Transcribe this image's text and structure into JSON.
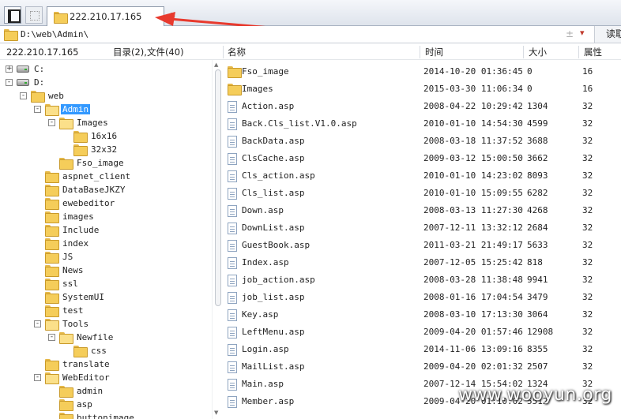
{
  "tab": {
    "label": "222.210.17.165",
    "add_label": "+"
  },
  "path_bar": {
    "value": "D:\\web\\Admin\\",
    "go_label": "读取",
    "pm": "±"
  },
  "tree_header": {
    "host": "222.210.17.165",
    "summary": "目录(2),文件(40)"
  },
  "columns": {
    "name": "名称",
    "time": "时间",
    "size": "大小",
    "attr": "属性"
  },
  "tree": [
    {
      "label": "C:",
      "level": 0,
      "type": "drive",
      "expander": "+"
    },
    {
      "label": "D:",
      "level": 0,
      "type": "drive",
      "expander": "-"
    },
    {
      "label": "web",
      "level": 1,
      "type": "folder",
      "expander": "-"
    },
    {
      "label": "Admin",
      "level": 2,
      "type": "folder-open",
      "expander": "-",
      "selected": true
    },
    {
      "label": "Images",
      "level": 3,
      "type": "folder-open",
      "expander": "-"
    },
    {
      "label": "16x16",
      "level": 4,
      "type": "folder",
      "expander": ""
    },
    {
      "label": "32x32",
      "level": 4,
      "type": "folder",
      "expander": ""
    },
    {
      "label": "Fso_image",
      "level": 3,
      "type": "folder",
      "expander": ""
    },
    {
      "label": "aspnet_client",
      "level": 2,
      "type": "folder",
      "expander": ""
    },
    {
      "label": "DataBaseJKZY",
      "level": 2,
      "type": "folder",
      "expander": ""
    },
    {
      "label": "ewebeditor",
      "level": 2,
      "type": "folder",
      "expander": ""
    },
    {
      "label": "images",
      "level": 2,
      "type": "folder",
      "expander": ""
    },
    {
      "label": "Include",
      "level": 2,
      "type": "folder",
      "expander": ""
    },
    {
      "label": "index",
      "level": 2,
      "type": "folder",
      "expander": ""
    },
    {
      "label": "JS",
      "level": 2,
      "type": "folder",
      "expander": ""
    },
    {
      "label": "News",
      "level": 2,
      "type": "folder",
      "expander": ""
    },
    {
      "label": "ssl",
      "level": 2,
      "type": "folder",
      "expander": ""
    },
    {
      "label": "SystemUI",
      "level": 2,
      "type": "folder",
      "expander": ""
    },
    {
      "label": "test",
      "level": 2,
      "type": "folder",
      "expander": ""
    },
    {
      "label": "Tools",
      "level": 2,
      "type": "folder-open",
      "expander": "-"
    },
    {
      "label": "Newfile",
      "level": 3,
      "type": "folder-open",
      "expander": "-"
    },
    {
      "label": "css",
      "level": 4,
      "type": "folder",
      "expander": ""
    },
    {
      "label": "translate",
      "level": 2,
      "type": "folder",
      "expander": ""
    },
    {
      "label": "WebEditor",
      "level": 2,
      "type": "folder-open",
      "expander": "-"
    },
    {
      "label": "admin",
      "level": 3,
      "type": "folder",
      "expander": ""
    },
    {
      "label": "asp",
      "level": 3,
      "type": "folder",
      "expander": ""
    },
    {
      "label": "buttonimage",
      "level": 3,
      "type": "folder",
      "expander": ""
    }
  ],
  "files": [
    {
      "name": "Fso_image",
      "time": "2014-10-20 01:36:45",
      "size": "0",
      "attr": "16",
      "type": "folder"
    },
    {
      "name": "Images",
      "time": "2015-03-30 11:06:34",
      "size": "0",
      "attr": "16",
      "type": "folder"
    },
    {
      "name": "Action.asp",
      "time": "2008-04-22 10:29:42",
      "size": "1304",
      "attr": "32",
      "type": "file"
    },
    {
      "name": "Back.Cls_list.V1.0.asp",
      "time": "2010-01-10 14:54:30",
      "size": "4599",
      "attr": "32",
      "type": "file"
    },
    {
      "name": "BackData.asp",
      "time": "2008-03-18 11:37:52",
      "size": "3688",
      "attr": "32",
      "type": "file"
    },
    {
      "name": "ClsCache.asp",
      "time": "2009-03-12 15:00:50",
      "size": "3662",
      "attr": "32",
      "type": "file"
    },
    {
      "name": "Cls_action.asp",
      "time": "2010-01-10 14:23:02",
      "size": "8093",
      "attr": "32",
      "type": "file"
    },
    {
      "name": "Cls_list.asp",
      "time": "2010-01-10 15:09:55",
      "size": "6282",
      "attr": "32",
      "type": "file"
    },
    {
      "name": "Down.asp",
      "time": "2008-03-13 11:27:30",
      "size": "4268",
      "attr": "32",
      "type": "file"
    },
    {
      "name": "DownList.asp",
      "time": "2007-12-11 13:32:12",
      "size": "2684",
      "attr": "32",
      "type": "file"
    },
    {
      "name": "GuestBook.asp",
      "time": "2011-03-21 21:49:17",
      "size": "5633",
      "attr": "32",
      "type": "file"
    },
    {
      "name": "Index.asp",
      "time": "2007-12-05 15:25:42",
      "size": "818",
      "attr": "32",
      "type": "file"
    },
    {
      "name": "job_action.asp",
      "time": "2008-03-28 11:38:48",
      "size": "9941",
      "attr": "32",
      "type": "file"
    },
    {
      "name": "job_list.asp",
      "time": "2008-01-16 17:04:54",
      "size": "3479",
      "attr": "32",
      "type": "file"
    },
    {
      "name": "Key.asp",
      "time": "2008-03-10 17:13:30",
      "size": "3064",
      "attr": "32",
      "type": "file"
    },
    {
      "name": "LeftMenu.asp",
      "time": "2009-04-20 01:57:46",
      "size": "12908",
      "attr": "32",
      "type": "file"
    },
    {
      "name": "Login.asp",
      "time": "2014-11-06 13:09:16",
      "size": "8355",
      "attr": "32",
      "type": "file"
    },
    {
      "name": "MailList.asp",
      "time": "2009-04-20 02:01:32",
      "size": "2507",
      "attr": "32",
      "type": "file"
    },
    {
      "name": "Main.asp",
      "time": "2007-12-14 15:54:02",
      "size": "1324",
      "attr": "32",
      "type": "file"
    },
    {
      "name": "Member.asp",
      "time": "2009-04-20 01:10:02",
      "size": "5512",
      "attr": "32",
      "type": "file"
    }
  ],
  "watermark": "www.wooyun.org",
  "colors": {
    "selection": "#3399ff",
    "folder": "#f5cd5a",
    "arrow": "#e83a2e"
  }
}
